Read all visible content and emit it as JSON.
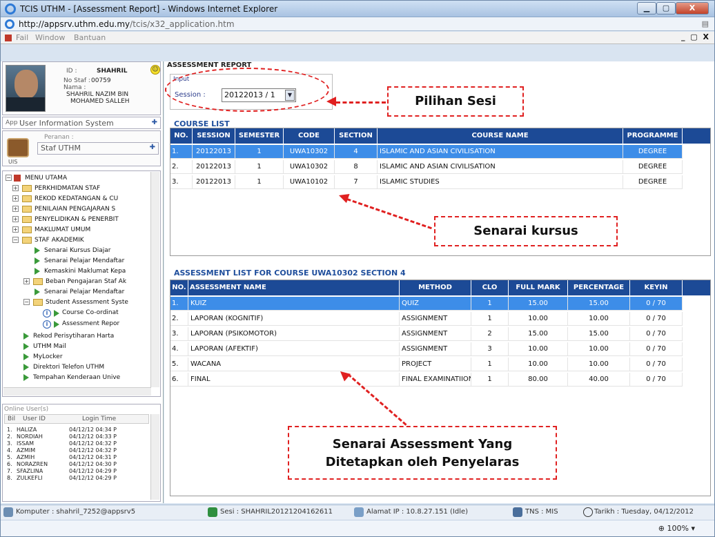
{
  "window": {
    "title": "TCIS UTHM - [Assessment Report] - Windows Internet Explorer",
    "url": "http://appsrv.uthm.edu.my/tcis/x32_application.htm",
    "url_host": "http://appsrv.uthm.edu.my",
    "url_path": "/tcis/x32_application.htm"
  },
  "menubar": {
    "items": [
      "Fail",
      "Window",
      "Bantuan"
    ],
    "mdi_controls": "_ ▢ X"
  },
  "profile": {
    "id_label": "ID :",
    "id_value": "SHAHRIL",
    "staff_label": "No Staf :",
    "staff_value": "00759",
    "name_label": "Nama :",
    "name_line1": "SHAHRIL NAZIM BIN",
    "name_line2": "MOHAMED SALLEH"
  },
  "app_select": {
    "label": "App :",
    "value": "User Information System"
  },
  "role": {
    "label": "Peranan :",
    "value": "Staf UTHM",
    "icon_caption": "UIS"
  },
  "tree": {
    "root": "MENU UTAMA",
    "folders": [
      "PERKHIDMATAN STAF",
      "REKOD KEDATANGAN & CU",
      "PENILAIAN PENGAJARAN S",
      "PENYELIDIKAN & PENERBIT",
      "MAKLUMAT UMUM",
      "STAF AKADEMIK"
    ],
    "akademik_items": [
      "Senarai Kursus Diajar",
      "Senarai Pelajar Mendaftar",
      "Kemaskini Maklumat Kepa",
      "Beban Pengajaran Staf Ak",
      "Senarai Pelajar Mendaftar",
      "Student Assessment Syste"
    ],
    "assessment_items": [
      "Course Co-ordinat",
      "Assessment Repor"
    ],
    "root_items": [
      "Rekod Perisytiharan Harta",
      "UTHM Mail",
      "MyLocker",
      "Direktori Telefon UTHM",
      "Tempahan Kenderaan Unive"
    ]
  },
  "online": {
    "title": "Online User(s)",
    "headers": {
      "bil": "Bil",
      "user_id": "User ID",
      "login_time": "Login Time"
    },
    "users": [
      {
        "no": "1.",
        "id": "HALIZA",
        "time": "04/12/12 04:34 P"
      },
      {
        "no": "2.",
        "id": "NORDIAH",
        "time": "04/12/12 04:33 P"
      },
      {
        "no": "3.",
        "id": "ISSAM",
        "time": "04/12/12 04:32 P"
      },
      {
        "no": "4.",
        "id": "AZMIM",
        "time": "04/12/12 04:32 P"
      },
      {
        "no": "5.",
        "id": "AZMIH",
        "time": "04/12/12 04:31 P"
      },
      {
        "no": "6.",
        "id": "NORAZREN",
        "time": "04/12/12 04:30 P"
      },
      {
        "no": "7.",
        "id": "SFAZLINA",
        "time": "04/12/12 04:29 P"
      },
      {
        "no": "8.",
        "id": "ZULKEFLI",
        "time": "04/12/12 04:29 P"
      }
    ]
  },
  "report": {
    "header": "ASSESSMENT REPORT",
    "input_label": "Input",
    "session_label": "Session :",
    "session_value": "20122013 / 1",
    "course_list_title": "COURSE LIST",
    "course_headers": [
      "NO.",
      "SESSION",
      "SEMESTER",
      "CODE",
      "SECTION",
      "COURSE NAME",
      "PROGRAMME"
    ],
    "courses": [
      {
        "no": "1.",
        "session": "20122013",
        "semester": "1",
        "code": "UWA10302",
        "section": "4",
        "name": "ISLAMIC AND ASIAN CIVILISATION",
        "programme": "DEGREE"
      },
      {
        "no": "2.",
        "session": "20122013",
        "semester": "1",
        "code": "UWA10302",
        "section": "8",
        "name": "ISLAMIC AND ASIAN CIVILISATION",
        "programme": "DEGREE"
      },
      {
        "no": "3.",
        "session": "20122013",
        "semester": "1",
        "code": "UWA10102",
        "section": "7",
        "name": "ISLAMIC STUDIES",
        "programme": "DEGREE"
      }
    ],
    "assessment_title": "ASSESSMENT LIST FOR COURSE UWA10302 SECTION  4",
    "assessment_headers": [
      "NO.",
      "ASSESSMENT NAME",
      "METHOD",
      "CLO",
      "FULL MARK",
      "PERCENTAGE",
      "KEYIN"
    ],
    "assessments": [
      {
        "no": "1.",
        "name": "KUIZ",
        "method": "QUIZ",
        "clo": "1",
        "full": "15.00",
        "pct": "15.00",
        "keyin": "0 / 70"
      },
      {
        "no": "2.",
        "name": "LAPORAN  (KOGNITIF)",
        "method": "ASSIGNMENT",
        "clo": "1",
        "full": "10.00",
        "pct": "10.00",
        "keyin": "0 / 70"
      },
      {
        "no": "3.",
        "name": "LAPORAN  (PSIKOMOTOR)",
        "method": "ASSIGNMENT",
        "clo": "2",
        "full": "15.00",
        "pct": "15.00",
        "keyin": "0 / 70"
      },
      {
        "no": "4.",
        "name": "LAPORAN  (AFEKTIF)",
        "method": "ASSIGNMENT",
        "clo": "3",
        "full": "10.00",
        "pct": "10.00",
        "keyin": "0 / 70"
      },
      {
        "no": "5.",
        "name": "WACANA",
        "method": "PROJECT",
        "clo": "1",
        "full": "10.00",
        "pct": "10.00",
        "keyin": "0 / 70"
      },
      {
        "no": "6.",
        "name": "FINAL",
        "method": "FINAL EXAMINATIION",
        "clo": "1",
        "full": "80.00",
        "pct": "40.00",
        "keyin": "0 / 70"
      }
    ]
  },
  "callouts": {
    "session": "Pilihan Sesi",
    "course": "Senarai kursus",
    "assessment_line1": "Senarai Assessment Yang",
    "assessment_line2": "Ditetapkan oleh Penyelaras"
  },
  "status": {
    "computer": "Komputer : shahril_7252@appsrv5",
    "session": "Sesi : SHAHRIL20121204162611",
    "ip": "Alamat IP : 10.8.27.151 (Idle)",
    "tns": "TNS : MIS",
    "date": "Tarikh : Tuesday, 04/12/2012"
  },
  "ie_status": {
    "zoom": "100%"
  },
  "colors": {
    "header_blue": "#1c4a96",
    "selected_row": "#3d8de8",
    "annotation_red": "#e02020"
  }
}
